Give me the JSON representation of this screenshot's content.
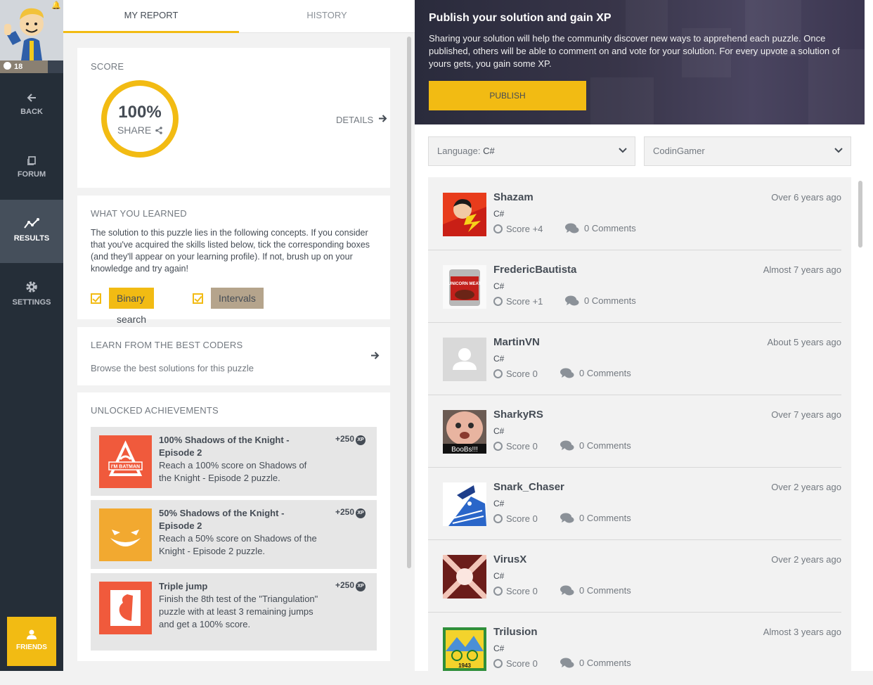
{
  "sidebar": {
    "level": "18",
    "nav": [
      {
        "label": "BACK",
        "icon": "arrow-left-icon"
      },
      {
        "label": "FORUM",
        "icon": "forum-icon"
      },
      {
        "label": "RESULTS",
        "icon": "chart-icon",
        "active": true
      },
      {
        "label": "SETTINGS",
        "icon": "gear-icon"
      }
    ],
    "friends_label": "FRIENDS"
  },
  "tabs": [
    {
      "label": "MY REPORT",
      "active": true
    },
    {
      "label": "HISTORY",
      "active": false
    }
  ],
  "score": {
    "title": "SCORE",
    "value": "100%",
    "share": "SHARE",
    "details": "DETAILS"
  },
  "learned": {
    "title": "WHAT YOU LEARNED",
    "text": "The solution to this puzzle lies in the following concepts. If you consider that you've acquired the skills listed below, tick the corresponding boxes (and they'll appear on your learning profile). If not, brush up on your knowledge and try again!",
    "concepts": [
      "Binary search",
      "Intervals"
    ]
  },
  "learn_best": {
    "title": "LEARN FROM THE BEST CODERS",
    "subtitle": "Browse the best solutions for this puzzle"
  },
  "achievements": {
    "title": "UNLOCKED ACHIEVEMENTS",
    "items": [
      {
        "title": "100% Shadows of the Knight - Episode 2",
        "desc": "Reach a 100% score on Shadows of the Knight - Episode 2 puzzle.",
        "xp": "+250",
        "xp_badge": "XP",
        "icon_text": "I'M BATMAN",
        "color": "#f05a3c"
      },
      {
        "title": "50% Shadows of the Knight - Episode 2",
        "desc": "Reach a 50% score on Shadows of the Knight - Episode 2 puzzle.",
        "xp": "+250",
        "xp_badge": "XP",
        "color": "#f2a930"
      },
      {
        "title": "Triple jump",
        "desc": "Finish the 8th test of the \"Triangulation\" puzzle with at least 3 remaining jumps and get a 100% score.",
        "xp": "+250",
        "xp_badge": "XP",
        "color": "#f05a3c"
      }
    ]
  },
  "publish": {
    "title": "Publish your solution and gain XP",
    "text": "Sharing your solution will help the community discover new ways to apprehend each puzzle. Once published, others will be able to comment on and vote for your solution. For every upvote a solution of yours gets, you gain some XP.",
    "button": "PUBLISH"
  },
  "filters": {
    "language_label": "Language:",
    "language_value": "C#",
    "author_value": "CodinGamer"
  },
  "solutions": [
    {
      "name": "Shazam",
      "lang": "C#",
      "score": "Score +4",
      "comments": "0 Comments",
      "date": "Over 6 years ago",
      "avatar": "shazam-avatar"
    },
    {
      "name": "FredericBautista",
      "lang": "C#",
      "score": "Score +1",
      "comments": "0 Comments",
      "date": "Almost 7 years ago",
      "avatar": "unicorn-meat-avatar",
      "avatar_text": "UNICORN MEAT"
    },
    {
      "name": "MartinVN",
      "lang": "C#",
      "score": "Score 0",
      "comments": "0 Comments",
      "date": "About 5 years ago",
      "avatar": "default-user-avatar"
    },
    {
      "name": "SharkyRS",
      "lang": "C#",
      "score": "Score 0",
      "comments": "0 Comments",
      "date": "Over 7 years ago",
      "avatar": "baby-avatar",
      "avatar_text": "BooBs!!!"
    },
    {
      "name": "Snark_Chaser",
      "lang": "C#",
      "score": "Score 0",
      "comments": "0 Comments",
      "date": "Over 2 years ago",
      "avatar": "snark-avatar"
    },
    {
      "name": "VirusX",
      "lang": "C#",
      "score": "Score 0",
      "comments": "0 Comments",
      "date": "Over 2 years ago",
      "avatar": "virus-avatar"
    },
    {
      "name": "Trilusion",
      "lang": "C#",
      "score": "Score 0",
      "comments": "0 Comments",
      "date": "Almost 3 years ago",
      "avatar": "bicycle-day-avatar",
      "avatar_text": "1943"
    }
  ]
}
